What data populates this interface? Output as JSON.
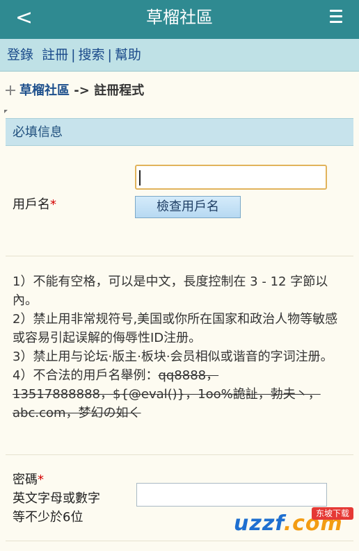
{
  "app": {
    "back_label": "<",
    "title": "草榴社區"
  },
  "navbar": {
    "login": "登錄",
    "register": "註冊",
    "search": "搜索",
    "help": "幫助",
    "sep": "|"
  },
  "breadcrumb": {
    "forum": "草榴社區",
    "arrow": "->",
    "current": "註冊程式"
  },
  "section": {
    "title": "必填信息"
  },
  "username": {
    "label": "用戶名",
    "required_mark": "*",
    "value": "",
    "check_button": "檢查用戶名"
  },
  "rules": {
    "line1": "1）不能有空格，可以是中文，長度控制在 3 - 12 字節以內。",
    "line2": "2）禁止用非常规符号,美国或你所在国家和政治人物等敏感或容易引起误解的侮辱性ID注册。",
    "line3": "3）禁止用与论坛·版主·板块·会员相似或谐音的字词注册。",
    "line4_prefix": "4）不合法的用戶名舉例：",
    "line4_examples": "qq8888，13517888888，${@eval()}，1oo%詭訨，勃夫丶，abc.com，梦幻の如く"
  },
  "password": {
    "label": "密碼",
    "required_mark": "*",
    "hint1": "英文字母或數字",
    "hint2": "等不少於6位",
    "value": ""
  },
  "watermark": {
    "text_a": "uzzf",
    "text_b": ".com",
    "badge": "东坡下载"
  }
}
